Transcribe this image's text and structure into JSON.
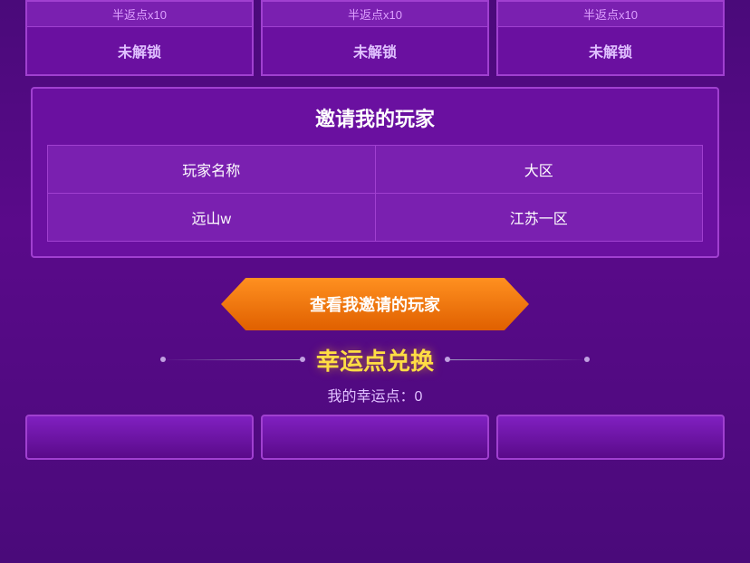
{
  "unlockCards": [
    {
      "top": "半返点x10",
      "btn": "未解锁"
    },
    {
      "top": "半返点x10",
      "btn": "未解锁"
    },
    {
      "top": "半返点x10",
      "btn": "未解锁"
    }
  ],
  "inviteSection": {
    "title": "邀请我的玩家",
    "tableHeaders": [
      "玩家名称",
      "大区"
    ],
    "tableRows": [
      [
        "远山w",
        "江苏一区"
      ]
    ]
  },
  "viewBtn": {
    "label": "查看我邀请的玩家"
  },
  "luckySection": {
    "title": "幸运点兑换",
    "points": "我的幸运点：0"
  }
}
